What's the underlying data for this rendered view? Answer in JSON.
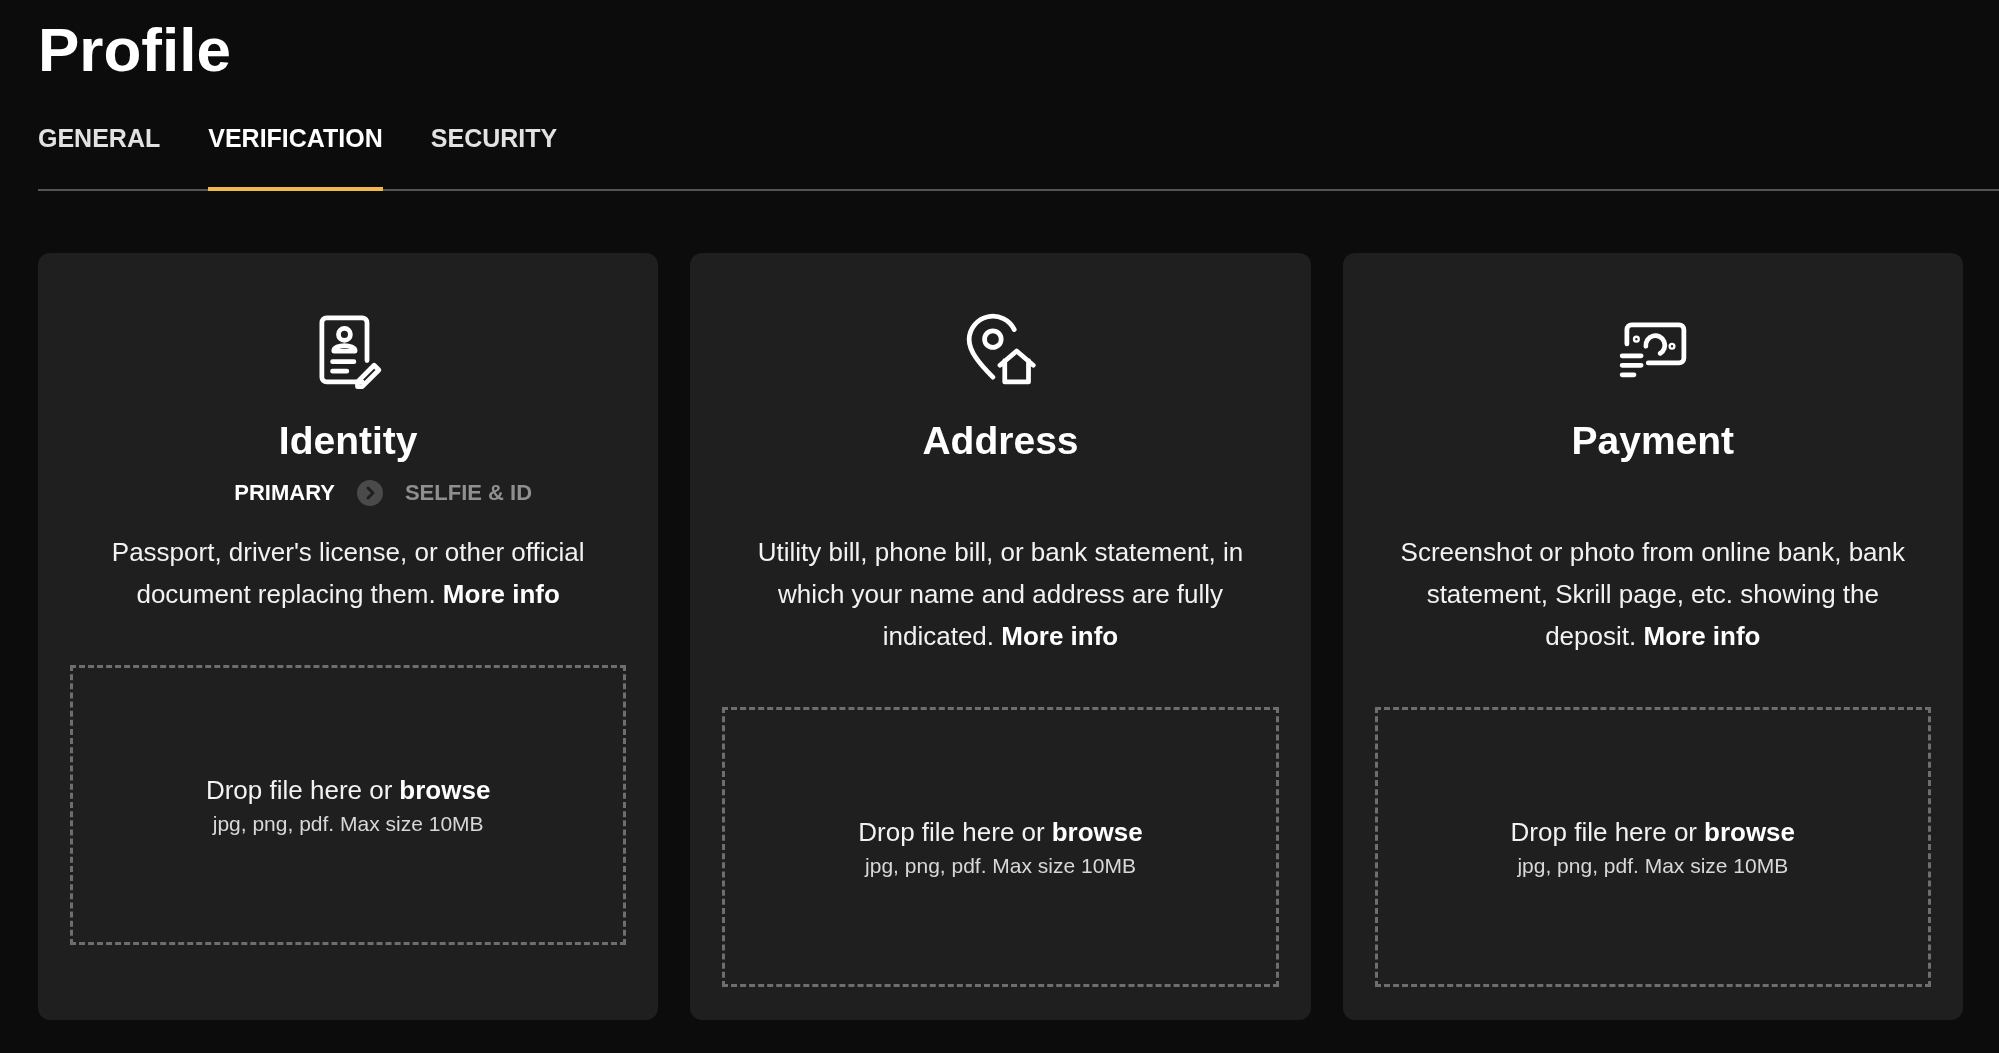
{
  "title": "Profile",
  "tabs": [
    {
      "label": "GENERAL",
      "selected": false
    },
    {
      "label": "VERIFICATION",
      "selected": true
    },
    {
      "label": "SECURITY",
      "selected": false
    }
  ],
  "cards": [
    {
      "kind": "identity",
      "title": "Identity",
      "steps": [
        {
          "label": "PRIMARY",
          "selected": true
        },
        {
          "label": "SELFIE & ID",
          "selected": false
        }
      ],
      "description": "Passport, driver's license, or other official document replacing them.",
      "link": "More info",
      "drop_text": "Drop file here or",
      "drop_action": "browse",
      "drop_hint": "jpg, png, pdf. Max size 10MB"
    },
    {
      "kind": "address",
      "title": "Address",
      "description": "Utility bill, phone bill, or bank statement, in which your name and address are fully indicated.",
      "link": "More info",
      "drop_text": "Drop file here or",
      "drop_action": "browse",
      "drop_hint": "jpg, png, pdf. Max size 10MB"
    },
    {
      "kind": "payment",
      "title": "Payment",
      "description": "Screenshot or photo from online bank, bank statement, Skrill page, etc. showing the deposit.",
      "link": "More info",
      "drop_text": "Drop file here or",
      "drop_action": "browse",
      "drop_hint": "jpg, png, pdf. Max size 10MB"
    }
  ]
}
